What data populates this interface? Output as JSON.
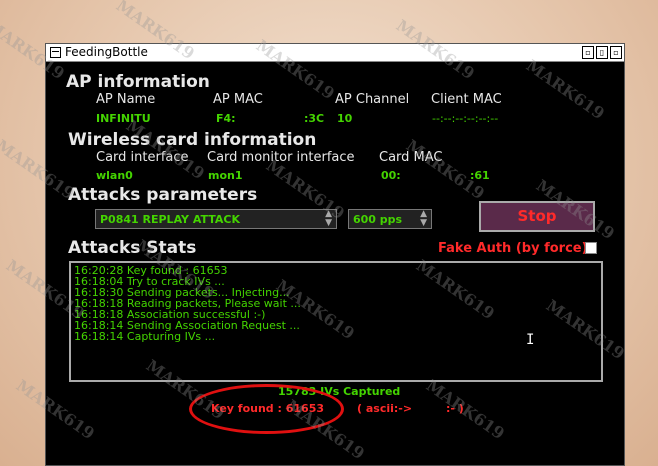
{
  "window": {
    "title": "FeedingBottle"
  },
  "ap_info": {
    "section_title": "AP information",
    "headers": {
      "ap_name": "AP Name",
      "ap_mac": "AP MAC",
      "ap_channel": "AP Channel",
      "client_mac": "Client MAC"
    },
    "values": {
      "ap_name": "INFINITU",
      "ap_mac_start": "F4:",
      "ap_mac_end": ":3C",
      "ap_channel": "10",
      "client_mac": "--:--:--:--:--:--"
    }
  },
  "card_info": {
    "section_title": "Wireless card information",
    "headers": {
      "card_interface": "Card interface",
      "monitor_interface": "Card monitor interface",
      "card_mac": "Card MAC"
    },
    "values": {
      "card_interface": "wlan0",
      "monitor_interface": "mon1",
      "card_mac_start": "00:",
      "card_mac_end": ":61"
    }
  },
  "attacks": {
    "section_title": "Attacks parameters",
    "attack_select": "P0841 REPLAY ATTACK",
    "rate_select": "600 pps",
    "stop_label": "Stop"
  },
  "stats": {
    "section_title": "Attacks Stats",
    "fake_auth_label": "Fake Auth (by force)",
    "log": [
      "16:20:28 Key found : 61653",
      "16:18:04 Try to crack IVs ...",
      "16:18:30 Sending packets... Injecting...",
      "16:18:18 Reading packets, Please wait ...",
      "16:18:18 Association successful :-)",
      "16:18:14 Sending Association Request ...",
      "16:18:14 Capturing IVs ..."
    ]
  },
  "status": {
    "ivs_captured": "15783 IVs Captured",
    "key_found": "Key found : 61653",
    "ascii_open": "( ascii:->",
    "ascii_close": ":- )"
  },
  "watermark": "MARK619",
  "colors": {
    "text_green": "#44d400",
    "alert_red": "#ff2a2a",
    "stop_bg": "#5a2a4a"
  }
}
